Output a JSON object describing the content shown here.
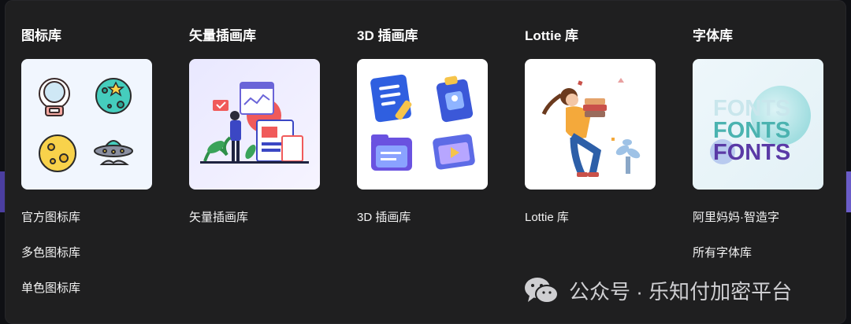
{
  "colors": {
    "panel_bg": "#1f1f20",
    "text": "#ffffff",
    "watermark": "#cfcfd2"
  },
  "columns": [
    {
      "title": "图标库",
      "card_icon": "icon-library-illustration",
      "links": [
        "官方图标库",
        "多色图标库",
        "单色图标库"
      ]
    },
    {
      "title": "矢量插画库",
      "card_icon": "vector-illustration",
      "links": [
        "矢量插画库"
      ]
    },
    {
      "title": "3D 插画库",
      "card_icon": "3d-illustration",
      "links": [
        "3D 插画库"
      ]
    },
    {
      "title": "Lottie 库",
      "card_icon": "lottie-illustration",
      "links": [
        "Lottie 库"
      ]
    },
    {
      "title": "字体库",
      "card_icon": "fonts-illustration",
      "links": [
        "阿里妈妈·智造字",
        "所有字体库"
      ]
    }
  ],
  "fonts_card": {
    "word": "FONTS"
  },
  "watermark": {
    "icon": "wechat-icon",
    "text": "公众号 · 乐知付加密平台"
  }
}
